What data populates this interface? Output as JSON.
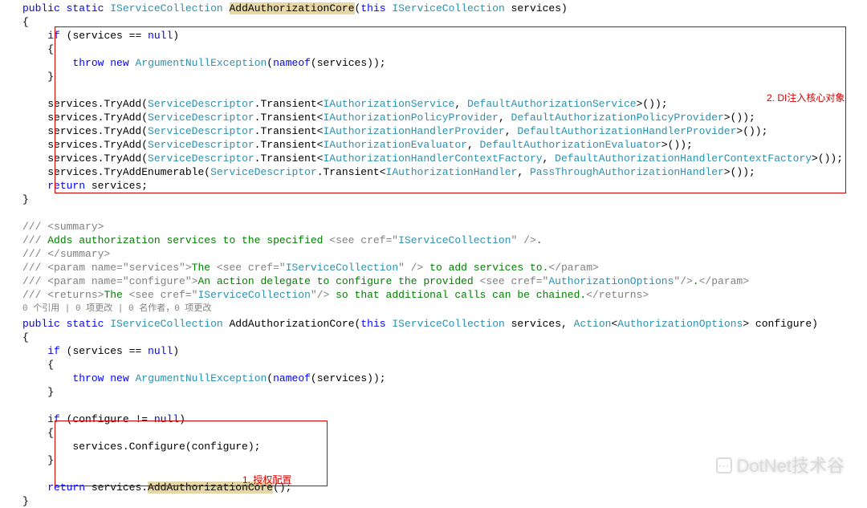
{
  "method1": {
    "sig": {
      "public": "public",
      "static": "static",
      "ret": "IServiceCollection",
      "name": "AddAuthorizationCore",
      "lp": "(",
      "this": "this",
      "ptype": "IServiceCollection",
      "pname": "services",
      "rp": ")"
    },
    "nullcheck": {
      "if": "if",
      "lp": " (",
      "svc": "services",
      "eq": " == ",
      "null": "null",
      "rp": ")",
      "throw": "throw",
      "new": "new",
      "ex": "ArgumentNullException",
      "elp": "(",
      "nameof": "nameof",
      "nlp": "(",
      "narg": "services",
      "nrp": ")",
      "erp": ");"
    },
    "lines": [
      {
        "pre": "services.TryAdd(",
        "sd": "ServiceDescriptor",
        "dot": ".Transient<",
        "i": "IAuthorizationService",
        "c": ", ",
        "d": "DefaultAuthorizationService",
        "post": ">());"
      },
      {
        "pre": "services.TryAdd(",
        "sd": "ServiceDescriptor",
        "dot": ".Transient<",
        "i": "IAuthorizationPolicyProvider",
        "c": ", ",
        "d": "DefaultAuthorizationPolicyProvider",
        "post": ">());"
      },
      {
        "pre": "services.TryAdd(",
        "sd": "ServiceDescriptor",
        "dot": ".Transient<",
        "i": "IAuthorizationHandlerProvider",
        "c": ", ",
        "d": "DefaultAuthorizationHandlerProvider",
        "post": ">());"
      },
      {
        "pre": "services.TryAdd(",
        "sd": "ServiceDescriptor",
        "dot": ".Transient<",
        "i": "IAuthorizationEvaluator",
        "c": ", ",
        "d": "DefaultAuthorizationEvaluator",
        "post": ">());"
      },
      {
        "pre": "services.TryAdd(",
        "sd": "ServiceDescriptor",
        "dot": ".Transient<",
        "i": "IAuthorizationHandlerContextFactory",
        "c": ", ",
        "d": "DefaultAuthorizationHandlerContextFactory",
        "post": ">());"
      },
      {
        "pre": "services.TryAddEnumerable(",
        "sd": "ServiceDescriptor",
        "dot": ".Transient<",
        "i": "IAuthorizationHandler",
        "c": ", ",
        "d": "PassThroughAuthorizationHandler",
        "post": ">());"
      }
    ],
    "ret": {
      "return": "return",
      "val": " services;"
    }
  },
  "xmlDoc": {
    "sum1": "/// ",
    "sumOpen": "<summary>",
    "sumText1": "Adds authorization services to the specified ",
    "see1Open": "<see cref=\"",
    "see1Ref": "IServiceCollection",
    "see1Close": "\" />",
    "sumText1End": ".",
    "sumClose": "</summary>",
    "p1Open": "<param name=\"",
    "p1Name": "services",
    "p1Close": "\">",
    "p1Text": "The ",
    "p1SeeOpen": "<see cref=\"",
    "p1SeeRef": "IServiceCollection",
    "p1SeeClose": "\" />",
    "p1Text2": " to add services to.",
    "p1End": "</param>",
    "p2Open": "<param name=\"",
    "p2Name": "configure",
    "p2Close": "\">",
    "p2Text": "An action delegate to configure the provided ",
    "p2SeeOpen": "<see cref=\"",
    "p2SeeRef": "AuthorizationOptions",
    "p2SeeClose": "\"/>",
    "p2Text2": ".",
    "p2End": "</param>",
    "retOpen": "<returns>",
    "retText": "The ",
    "retSeeOpen": "<see cref=\"",
    "retSeeRef": "IServiceCollection",
    "retSeeClose": "\"/>",
    "retText2": " so that additional calls can be chained.",
    "retEnd": "</returns>"
  },
  "codelens": "0 个引用 | 0 项更改 | 0 名作者，0 项更改",
  "method2": {
    "sig": {
      "public": "public",
      "static": "static",
      "ret": "IServiceCollection",
      "name": "AddAuthorizationCore",
      "lp": "(",
      "this": "this",
      "p1t": "IServiceCollection",
      "p1n": "services",
      "c": ", ",
      "action": "Action",
      "lt": "<",
      "opt": "AuthorizationOptions",
      "gt": ">",
      "p2n": " configure",
      "rp": ")"
    },
    "nullcheck": {
      "if": "if",
      "lp": " (",
      "svc": "services",
      "eq": " == ",
      "null": "null",
      "rp": ")",
      "throw": "throw",
      "new": "new",
      "ex": "ArgumentNullException",
      "elp": "(",
      "nameof": "nameof",
      "nlp": "(",
      "narg": "services",
      "nrp": ")",
      "erp": ");"
    },
    "cfg": {
      "if": "if",
      "lp": " (",
      "cfg": "configure",
      "ne": " != ",
      "null": "null",
      "rp": ")",
      "call": "services.Configure(configure);"
    },
    "ret": {
      "return": "return",
      "pre": " services.",
      "call": "AddAuthorizationCore",
      "post": "();"
    }
  },
  "annotations": {
    "a1": "1. 授权配置",
    "a2": "2. DI注入核心对象"
  },
  "watermark": {
    "icon": "💬",
    "text": "DotNet技术谷"
  }
}
